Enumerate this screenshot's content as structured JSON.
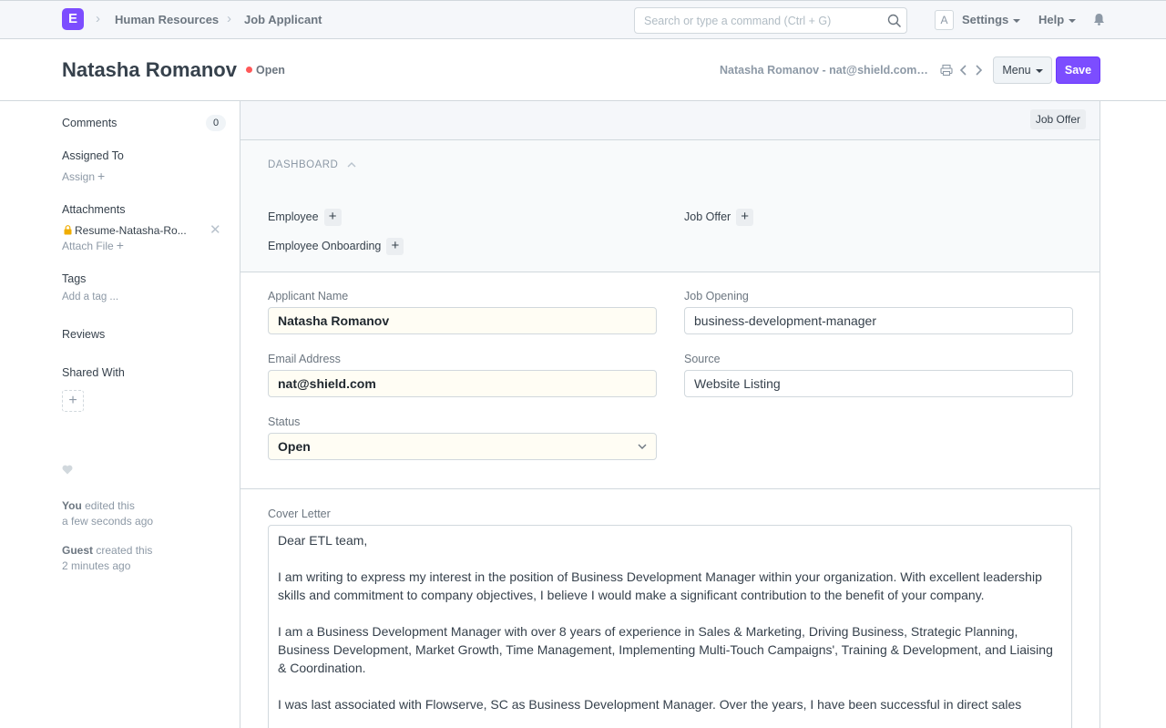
{
  "navbar": {
    "logo_letter": "E",
    "breadcrumbs": [
      "Human Resources",
      "Job Applicant"
    ],
    "search_placeholder": "Search or type a command (Ctrl + G)",
    "avatar_letter": "A",
    "settings_label": "Settings",
    "help_label": "Help"
  },
  "page_head": {
    "title": "Natasha Romanov",
    "status": "Open",
    "status_color": "#ff5858",
    "doc_title": "Natasha Romanov - nat@shield.com -...",
    "menu_label": "Menu",
    "save_label": "Save",
    "accent": "#7c4dff"
  },
  "sidebar": {
    "comments_label": "Comments",
    "comments_count": "0",
    "assigned_to_label": "Assigned To",
    "assign_label": "Assign",
    "attachments_label": "Attachments",
    "attachment_file": "Resume-Natasha-Ro...",
    "attach_file_label": "Attach File",
    "tags_label": "Tags",
    "add_tag_label": "Add a tag ...",
    "reviews_label": "Reviews",
    "shared_with_label": "Shared With",
    "timeline": [
      {
        "who": "You",
        "action": "edited this",
        "when": "a few seconds ago"
      },
      {
        "who": "Guest",
        "action": "created this",
        "when": "2 minutes ago"
      }
    ]
  },
  "form": {
    "job_offer_tag": "Job Offer",
    "dashboard_label": "DASHBOARD",
    "connections": [
      "Employee",
      "Job Offer",
      "Employee Onboarding"
    ],
    "fields": {
      "applicant_name": {
        "label": "Applicant Name",
        "value": "Natasha Romanov"
      },
      "job_opening": {
        "label": "Job Opening",
        "value": "business-development-manager"
      },
      "email_address": {
        "label": "Email Address",
        "value": "nat@shield.com"
      },
      "source": {
        "label": "Source",
        "value": "Website Listing"
      },
      "status": {
        "label": "Status",
        "value": "Open"
      }
    },
    "cover_letter_label": "Cover Letter",
    "cover_letter": [
      "Dear ETL team,",
      "I am writing to express my interest in the position of Business Development Manager within your organization. With excellent leadership skills and commitment to company objectives, I believe I would make a significant contribution to the benefit of your company.",
      "I am a Business Development Manager with over 8 years of experience in Sales & Marketing, Driving Business, Strategic Planning, Business Development, Market Growth, Time Management, Implementing Multi-Touch Campaigns', Training & Development, and Liaising & Coordination.",
      "I was last associated with Flowserve, SC as Business Development Manager. Over the years, I have been successful in direct sales"
    ]
  }
}
